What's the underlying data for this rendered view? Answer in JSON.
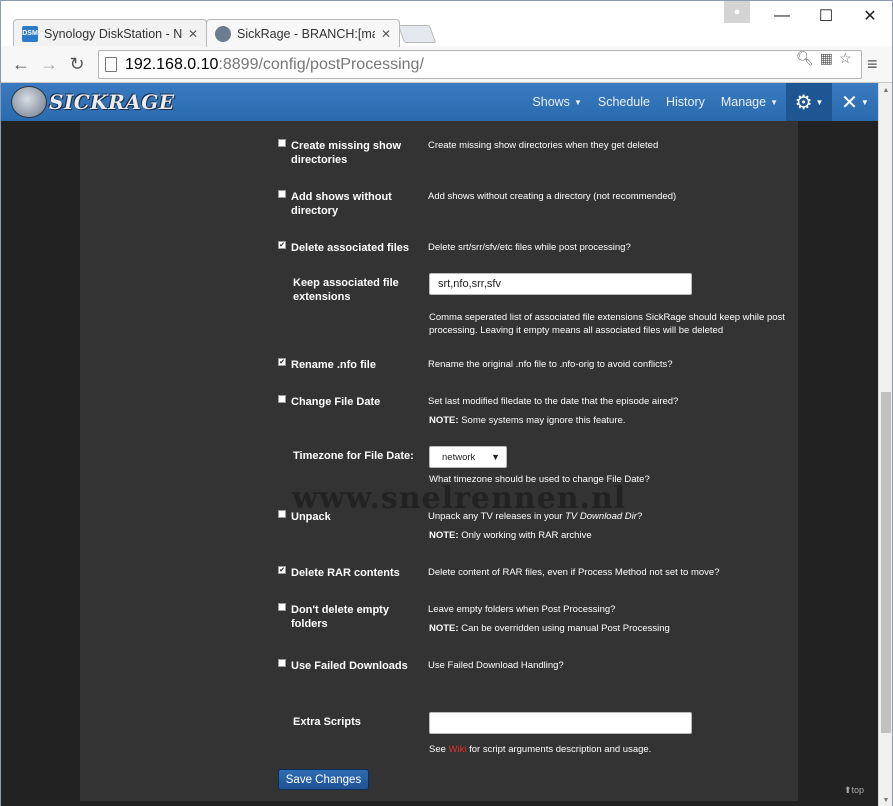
{
  "browser": {
    "tabs": [
      {
        "title": "Synology DiskStation - NA",
        "favicon": "DSM",
        "active": false
      },
      {
        "title": "SickRage - BRANCH:[maste",
        "favicon": "sickrage-icon",
        "active": true
      }
    ],
    "url_host": "192.168.0.10",
    "url_path": ":8899/config/postProcessing/"
  },
  "nav": {
    "logo_text": "SICKRAGE",
    "items": [
      "Shows",
      "Schedule",
      "History",
      "Manage"
    ]
  },
  "settings": {
    "create_missing": {
      "label": "Create missing show directories",
      "checked": false,
      "desc": "Create missing show directories when they get deleted"
    },
    "add_without_dir": {
      "label": "Add shows without directory",
      "checked": false,
      "desc": "Add shows without creating a directory (not recommended)"
    },
    "delete_associated": {
      "label": "Delete associated files",
      "checked": true,
      "desc": "Delete srt/srr/sfv/etc files while post processing?"
    },
    "keep_extensions": {
      "label": "Keep associated file extensions",
      "value": "srt,nfo,srr,sfv",
      "desc": "Comma seperated list of associated file extensions SickRage should keep while post processing. Leaving it empty means all associated files will be deleted"
    },
    "rename_nfo": {
      "label": "Rename .nfo file",
      "checked": true,
      "desc": "Rename the original .nfo file to .nfo-orig to avoid conflicts?"
    },
    "change_file_date": {
      "label": "Change File Date",
      "checked": false,
      "desc": "Set last modified filedate to the date that the episode aired?",
      "note_label": "NOTE:",
      "note_text": "Some systems may ignore this feature."
    },
    "timezone": {
      "label": "Timezone for File Date:",
      "value": "network",
      "desc": "What timezone should be used to change File Date?"
    },
    "unpack": {
      "label": "Unpack",
      "checked": false,
      "desc_before": "Unpack any TV releases in your ",
      "desc_em": "TV Download Dir",
      "desc_after": "?",
      "note_label": "NOTE:",
      "note_text": "Only working with RAR archive"
    },
    "delete_rar": {
      "label": "Delete RAR contents",
      "checked": true,
      "desc": "Delete content of RAR files, even if Process Method not set to move?"
    },
    "dont_delete_empty": {
      "label": "Don't delete empty folders",
      "checked": false,
      "desc": "Leave empty folders when Post Processing?",
      "note_label": "NOTE:",
      "note_text": "Can be overridden using manual Post Processing"
    },
    "use_failed": {
      "label": "Use Failed Downloads",
      "checked": false,
      "desc": "Use Failed Download Handling?"
    },
    "extra_scripts": {
      "label": "Extra Scripts",
      "value": "",
      "desc_before": "See ",
      "desc_link": "Wiki",
      "desc_after": " for script arguments description and usage."
    }
  },
  "save_label": "Save Changes",
  "watermark": "www.snelrennen.nl",
  "to_top": "top"
}
